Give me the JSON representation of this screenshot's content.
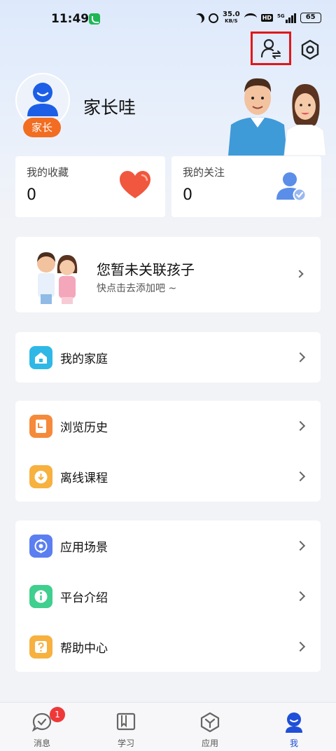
{
  "status_bar": {
    "time": "11:49",
    "speed_value": "35.0",
    "speed_unit": "KB/S",
    "hd": "HD",
    "network": "5G",
    "battery": "65"
  },
  "header": {
    "switch_identity_icon": "person-swap-icon",
    "settings_icon": "gear-icon"
  },
  "profile": {
    "name": "家长哇",
    "role": "家长"
  },
  "stats": {
    "favorites_label": "我的收藏",
    "favorites_count": "0",
    "follows_label": "我的关注",
    "follows_count": "0"
  },
  "child_card": {
    "title": "您暂未关联孩子",
    "subtitle": "快点击去添加吧 ~"
  },
  "menu": {
    "family": "我的家庭",
    "history": "浏览历史",
    "offline": "离线课程",
    "scenes": "应用场景",
    "intro": "平台介绍",
    "help": "帮助中心"
  },
  "nav": {
    "messages": "消息",
    "messages_badge": "1",
    "study": "学习",
    "apps": "应用",
    "me": "我"
  },
  "colors": {
    "accent": "#1f4fd8",
    "badge": "#f26d22",
    "highlight_border": "#e0181b"
  }
}
